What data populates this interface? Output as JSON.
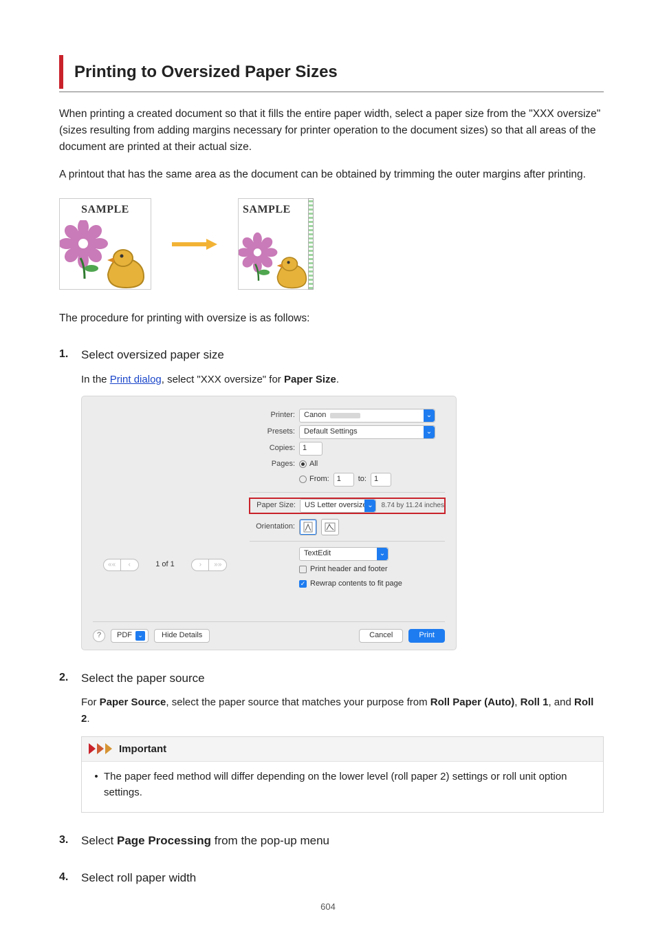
{
  "title": "Printing to Oversized Paper Sizes",
  "intro_p1": "When printing a created document so that it fills the entire paper width, select a paper size from the \"XXX oversize\" (sizes resulting from adding margins necessary for printer operation to the document sizes) so that all areas of the document are printed at their actual size.",
  "intro_p2": "A printout that has the same area as the document can be obtained by trimming the outer margins after printing.",
  "sample_label": "SAMPLE",
  "procedure_lead": "The procedure for printing with oversize is as follows:",
  "steps": {
    "s1": {
      "title": "Select oversized paper size",
      "pre": "In the ",
      "link": "Print dialog",
      "post": ", select \"XXX oversize\" for ",
      "bold": "Paper Size",
      "tail": "."
    },
    "s2": {
      "title": "Select the paper source",
      "pre": "For ",
      "b1": "Paper Source",
      "mid": ", select the paper source that matches your purpose from ",
      "b2": "Roll Paper (Auto)",
      "sep1": ", ",
      "b3": "Roll 1",
      "sep2": ", and ",
      "b4": "Roll 2",
      "tail": ".",
      "important_title": "Important",
      "important_item": "The paper feed method will differ depending on the lower level (roll paper 2) settings or roll unit option settings."
    },
    "s3": {
      "pre": "Select ",
      "bold": "Page Processing",
      "post": " from the pop-up menu"
    },
    "s4": {
      "title": "Select roll paper width"
    }
  },
  "dialog": {
    "printer_label": "Printer:",
    "printer_value": "Canon",
    "presets_label": "Presets:",
    "presets_value": "Default Settings",
    "copies_label": "Copies:",
    "copies_value": "1",
    "pages_label": "Pages:",
    "pages_all": "All",
    "pages_from": "From:",
    "pages_from_v": "1",
    "pages_to": "to:",
    "pages_to_v": "1",
    "papersize_label": "Paper Size:",
    "papersize_value": "US Letter oversize",
    "papersize_dim": "8.74 by 11.24 inches",
    "orientation_label": "Orientation:",
    "app_sel": "TextEdit",
    "opt1": "Print header and footer",
    "opt2": "Rewrap contents to fit page",
    "nav_count": "1 of 1",
    "help": "?",
    "pdf": "PDF",
    "hide": "Hide Details",
    "cancel": "Cancel",
    "print": "Print"
  },
  "page_number": "604"
}
